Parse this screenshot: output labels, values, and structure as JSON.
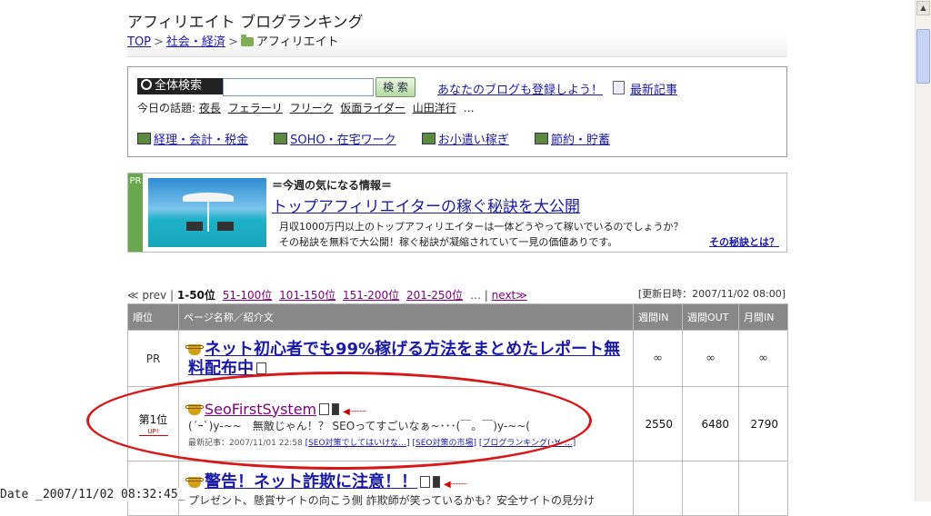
{
  "site": {
    "title": "アフィリエイト ブログランキング",
    "breadcrumb": [
      "TOP",
      "社会・経済",
      "アフィリエイト"
    ]
  },
  "search": {
    "label": "全体検索",
    "input_value": "",
    "button": "検 索",
    "register_link": "あなたのブログも登録しよう！",
    "latest_link": "最新記事",
    "topics_label": "今日の話題:",
    "topics": [
      "夜長",
      "フェラーリ",
      "フリーク",
      "仮面ライダー",
      "山田洋行",
      "…"
    ],
    "categories": [
      "経理・会計・税金",
      "SOHO・在宅ワーク",
      "お小遣い稼ぎ",
      "節約・貯蓄"
    ]
  },
  "ad": {
    "label": "PR",
    "eyebrow": "＝今週の気になる情報＝",
    "headline": "トップアフィリエイターの稼ぐ秘訣を大公開",
    "text1": "月収1000万円以上のトップアフィリエイターは一体どうやって稼いでいるのでしょうか？",
    "text2": "その秘訣を無料で大公開！稼ぐ秘訣が凝縮されていて一見の価値ありです。",
    "more": "その秘訣とは？"
  },
  "pager": {
    "prev": "≪ prev",
    "sep": "|",
    "current": "1-50位",
    "pages": [
      "51-100位",
      "101-150位",
      "151-200位",
      "201-250位"
    ],
    "ellipsis": "…",
    "next": "next≫"
  },
  "updated": "[更新日時：2007/11/02 08:00]",
  "table": {
    "headers": [
      "順位",
      "ページ名称／紹介文",
      "週間IN",
      "週間OUT",
      "月間IN"
    ],
    "rows": [
      {
        "rank": "PR",
        "title": "ネット初心者でも99%稼げる方法をまとめたレポート無料配布中",
        "in": "∞",
        "out": "∞",
        "month": "∞"
      },
      {
        "rank": "第1位",
        "badge": "UP!",
        "title": "SeoFirstSystem",
        "desc": "(´ｰ`)y-~~　無敵じゃん！？ SEOってすごいなぁ~･･･(￣。￣)y-~~(",
        "meta_label": "最新記事：",
        "meta_date": "2007/11/01 22:58",
        "meta_links": [
          "[SEO対策でしてはいけな…]",
          "[SEO対策の市場]",
          "[ブログランキング(･∀･…]"
        ],
        "in": "2550",
        "out": "6480",
        "month": "2790"
      },
      {
        "rank": "",
        "title": "警告！ネット詐欺に注意！！",
        "desc": "プレゼント、懸賞サイトの向こう側 詐欺師が笑っているかも？安全サイトの見分け",
        "in": "",
        "out": "",
        "month": ""
      }
    ]
  },
  "timestamp": "Date _2007/11/02 08:32:45_",
  "colors": {
    "link": "#1a1aa6",
    "visited": "#800080",
    "highlight": "#d81818",
    "ad_strip": "#6aa84f"
  }
}
